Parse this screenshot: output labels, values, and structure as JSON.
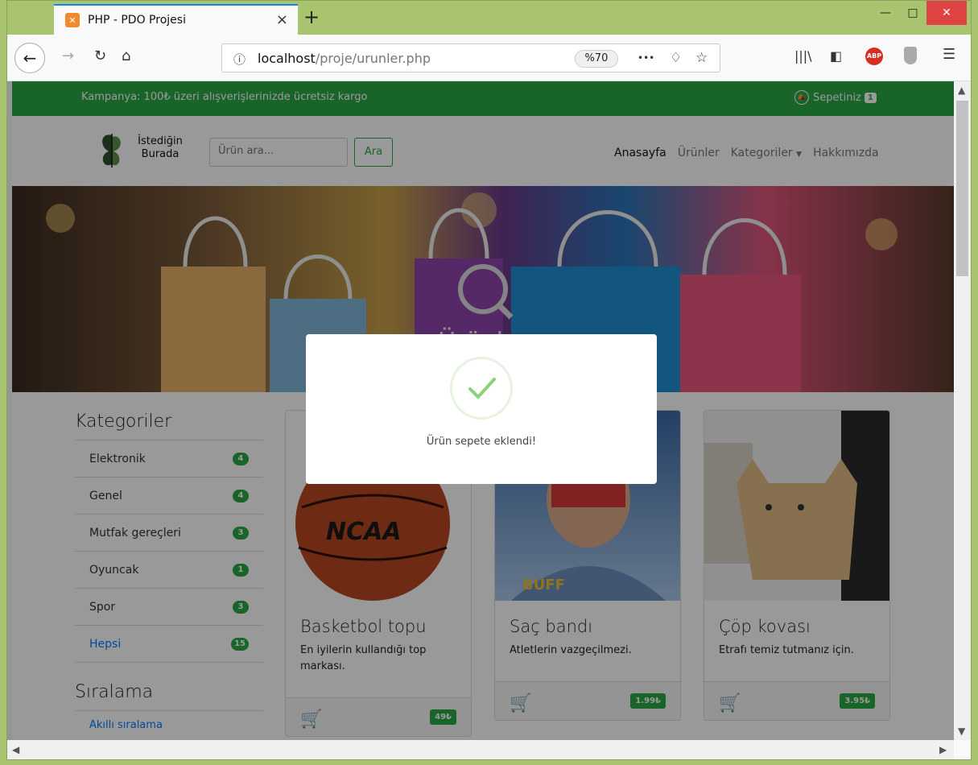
{
  "browser": {
    "tab_title": "PHP - PDO Projesi",
    "tab_close": "×",
    "new_tab": "+",
    "url_host": "localhost",
    "url_path": "/proje/urunler.php",
    "zoom": "%70",
    "more_icon": "•••"
  },
  "site": {
    "promo": "Kampanya: 100₺ üzeri alışverişlerinizde ücretsiz kargo",
    "cart_label": "Sepetiniz",
    "cart_count": "1",
    "logo_line1": "İstediğin",
    "logo_line2": "Burada",
    "search_placeholder": "Ürün ara...",
    "search_button": "Ara",
    "nav": [
      "Anasayfa",
      "Ürünler",
      "Kategoriler",
      "Hakkımızda"
    ],
    "hero_title": "Ürünler"
  },
  "sidebar": {
    "categories_heading": "Kategoriler",
    "categories": [
      {
        "label": "Elektronik",
        "count": "4"
      },
      {
        "label": "Genel",
        "count": "4"
      },
      {
        "label": "Mutfak gereçleri",
        "count": "3"
      },
      {
        "label": "Oyuncak",
        "count": "1"
      },
      {
        "label": "Spor",
        "count": "3"
      },
      {
        "label": "Hepsi",
        "count": "15"
      }
    ],
    "sort_heading": "Sıralama",
    "sort_first": "Akıllı sıralama"
  },
  "products": [
    {
      "title": "Basketbol topu",
      "desc": "En iyilerin kullandığı top markası.",
      "price": "49₺"
    },
    {
      "title": "Saç bandı",
      "desc": "Atletlerin vazgeçilmezi.",
      "price": "1.99₺"
    },
    {
      "title": "Çöp kovası",
      "desc": "Etrafı temiz tutmanız için.",
      "price": "3.95₺"
    }
  ],
  "modal": {
    "message": "Ürün sepete eklendi!"
  },
  "colors": {
    "accent": "#28a745",
    "link": "#007bff",
    "titlebar": "#a8c46e"
  }
}
